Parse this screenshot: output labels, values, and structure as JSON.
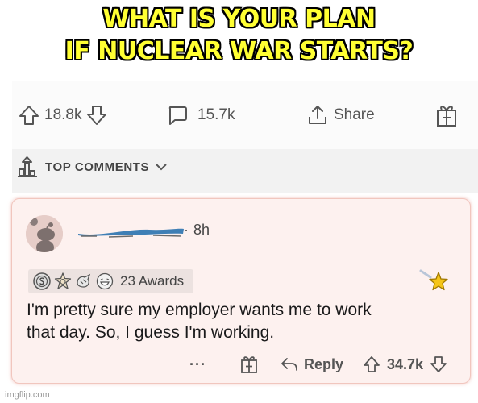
{
  "meme_caption": {
    "line1": "WHAT IS YOUR PLAN",
    "line2": "IF NUCLEAR WAR STARTS?"
  },
  "post_actions": {
    "upvotes": "18.8k",
    "comments": "15.7k",
    "share_label": "Share"
  },
  "comments_header": {
    "label": "TOP COMMENTS"
  },
  "comment": {
    "time": "8h",
    "awards_count_text": "23 Awards",
    "body_line1": "I'm pretty sure my employer wants me to work",
    "body_line2": "that day. So, I guess I'm working.",
    "more_label": "···",
    "reply_label": "Reply",
    "score": "34.7k"
  },
  "watermark": "imgflip.com",
  "icons": [
    "upvote-icon",
    "downvote-icon",
    "comment-bubble-icon",
    "share-icon",
    "gift-icon",
    "chevron-down-icon",
    "reply-arrow-icon",
    "star-award-icon"
  ],
  "colors": {
    "caption_fill": "#ffff33",
    "caption_outline": "#000000",
    "card_background": "#fdf1ef",
    "card_border": "#f1c6be",
    "award_star": "#f5c518"
  }
}
